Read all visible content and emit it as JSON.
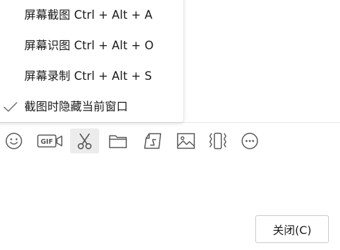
{
  "menu": {
    "items": [
      {
        "label": "屏幕截图 Ctrl + Alt + A",
        "checked": false
      },
      {
        "label": "屏幕识图 Ctrl + Alt + O",
        "checked": false
      },
      {
        "label": "屏幕录制 Ctrl + Alt + S",
        "checked": false
      },
      {
        "label": "截图时隐藏当前窗口",
        "checked": true
      }
    ]
  },
  "toolbar": {
    "buttons": [
      {
        "icon": "emoji-icon"
      },
      {
        "icon": "gif-icon",
        "text": "GIF"
      },
      {
        "icon": "scissors-icon",
        "active": true
      },
      {
        "icon": "folder-icon"
      },
      {
        "icon": "file-transfer-icon"
      },
      {
        "icon": "image-icon"
      },
      {
        "icon": "shake-window-icon"
      },
      {
        "icon": "more-icon"
      }
    ]
  },
  "footer": {
    "close_label": "关闭(C)"
  },
  "colors": {
    "icon": "#555555",
    "check": "#666666",
    "active_bg": "#ececec",
    "border": "#c9c9c9"
  }
}
